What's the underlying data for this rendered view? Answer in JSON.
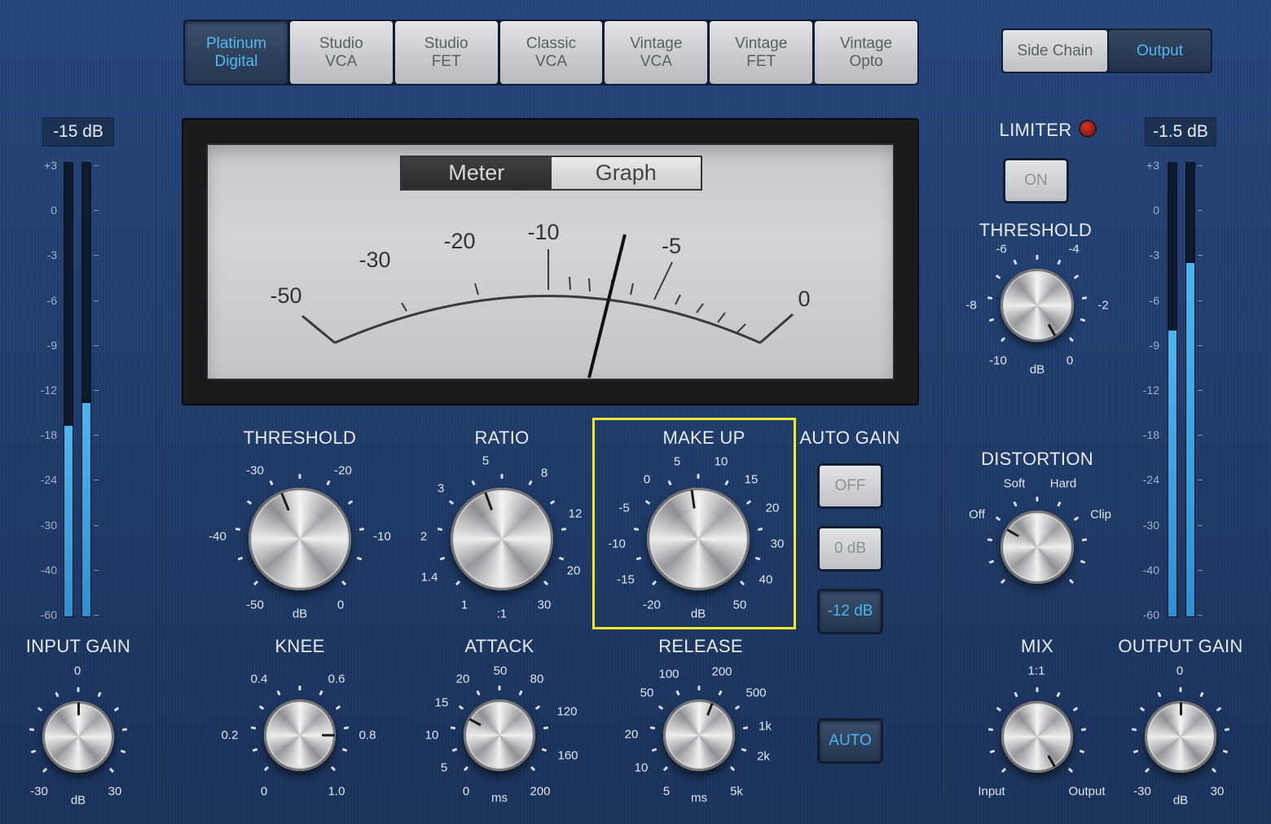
{
  "models": [
    {
      "label": "Platinum\nDigital",
      "active": true
    },
    {
      "label": "Studio\nVCA",
      "active": false
    },
    {
      "label": "Studio\nFET",
      "active": false
    },
    {
      "label": "Classic\nVCA",
      "active": false
    },
    {
      "label": "Vintage\nVCA",
      "active": false
    },
    {
      "label": "Vintage\nFET",
      "active": false
    },
    {
      "label": "Vintage\nOpto",
      "active": false
    }
  ],
  "view_toggle": {
    "side_chain": "Side Chain",
    "output": "Output",
    "active": "Output"
  },
  "input_meter": {
    "readout": "-15 dB",
    "level_left": 0.42,
    "level_right": 0.47
  },
  "output_meter": {
    "readout": "-1.5 dB",
    "level_left": 0.63,
    "level_right": 0.78
  },
  "meter_scale": [
    "+3",
    "0",
    "-3",
    "-6",
    "-9",
    "-12",
    "-18",
    "-24",
    "-30",
    "-40",
    "-60"
  ],
  "vu": {
    "tabs": [
      {
        "label": "Meter",
        "active": true
      },
      {
        "label": "Graph",
        "active": false
      }
    ],
    "scale": [
      "-50",
      "-30",
      "-20",
      "-10",
      "-5",
      "0"
    ]
  },
  "knobs": {
    "threshold": {
      "title": "THRESHOLD",
      "unit": "dB",
      "labels": [
        "-30",
        "-20",
        "-40",
        "-10",
        "-50",
        "0"
      ]
    },
    "ratio": {
      "title": "RATIO",
      "unit": ":1",
      "labels": [
        "5",
        "3",
        "8",
        "2",
        "12",
        "1.4",
        "20",
        "1",
        "30"
      ]
    },
    "makeup": {
      "title": "MAKE UP",
      "unit": "dB",
      "labels": [
        "5",
        "10",
        "0",
        "15",
        "-5",
        "20",
        "-10",
        "30",
        "-15",
        "40",
        "-20",
        "50"
      ]
    },
    "knee": {
      "title": "KNEE",
      "labels": [
        "0.4",
        "0.6",
        "0.2",
        "0.8",
        "0",
        "1.0"
      ]
    },
    "attack": {
      "title": "ATTACK",
      "unit": "ms",
      "labels": [
        "50",
        "20",
        "80",
        "15",
        "120",
        "10",
        "160",
        "5",
        "0",
        "200"
      ]
    },
    "release": {
      "title": "RELEASE",
      "unit": "ms",
      "labels": [
        "100",
        "200",
        "50",
        "500",
        "20",
        "1k",
        "10",
        "2k",
        "5",
        "5k"
      ]
    },
    "input_gain": {
      "title": "INPUT GAIN",
      "unit": "dB",
      "labels": [
        "0",
        "-30",
        "30"
      ]
    },
    "output_gain": {
      "title": "OUTPUT GAIN",
      "unit": "dB",
      "labels": [
        "0",
        "-30",
        "30"
      ]
    },
    "mix": {
      "title": "MIX",
      "labels": [
        "1:1",
        "Input",
        "Output"
      ]
    },
    "limiter_threshold": {
      "title": "THRESHOLD",
      "unit": "dB",
      "labels": [
        "-6",
        "-4",
        "-8",
        "-2",
        "-10",
        "0"
      ]
    },
    "distortion": {
      "title": "DISTORTION",
      "labels": [
        "Soft",
        "Hard",
        "Off",
        "Clip"
      ]
    }
  },
  "auto_gain": {
    "title": "AUTO GAIN",
    "off": "OFF",
    "zero": "0 dB",
    "minus12": "-12 dB",
    "active": "-12 dB"
  },
  "auto_button": "AUTO",
  "limiter": {
    "title": "LIMITER",
    "on": "ON"
  }
}
